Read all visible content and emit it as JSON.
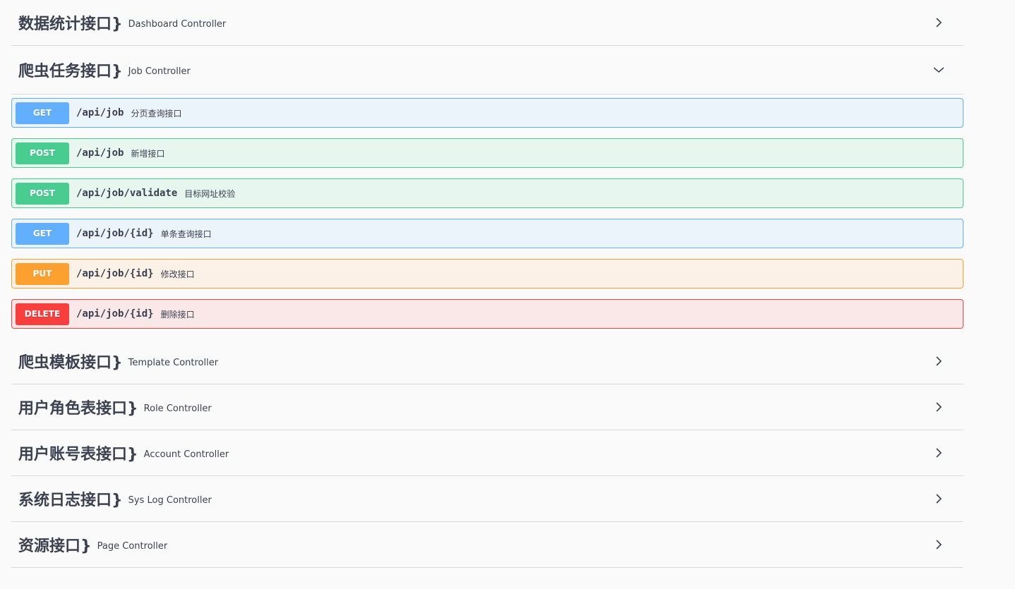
{
  "tags": [
    {
      "title": "数据统计接口}",
      "desc": "Dashboard Controller",
      "expanded": false
    },
    {
      "title": "爬虫任务接口}",
      "desc": "Job Controller",
      "expanded": true,
      "operations": [
        {
          "method": "GET",
          "path": "/api/job",
          "summary": "分页查询接口"
        },
        {
          "method": "POST",
          "path": "/api/job",
          "summary": "新增接口"
        },
        {
          "method": "POST",
          "path": "/api/job/validate",
          "summary": "目标网址校验"
        },
        {
          "method": "GET",
          "path": "/api/job/{id}",
          "summary": "单条查询接口"
        },
        {
          "method": "PUT",
          "path": "/api/job/{id}",
          "summary": "修改接口"
        },
        {
          "method": "DELETE",
          "path": "/api/job/{id}",
          "summary": "删除接口"
        }
      ]
    },
    {
      "title": "爬虫模板接口}",
      "desc": "Template Controller",
      "expanded": false
    },
    {
      "title": "用户角色表接口}",
      "desc": "Role Controller",
      "expanded": false
    },
    {
      "title": "用户账号表接口}",
      "desc": "Account Controller",
      "expanded": false
    },
    {
      "title": "系统日志接口}",
      "desc": "Sys Log Controller",
      "expanded": false
    },
    {
      "title": "资源接口}",
      "desc": "Page Controller",
      "expanded": false
    }
  ],
  "icons": {
    "collapsed": "chevron-right-icon",
    "expanded": "chevron-down-icon"
  },
  "colors": {
    "GET": "#61affe",
    "POST": "#49cc90",
    "PUT": "#fca130",
    "DELETE": "#f93e3e"
  }
}
